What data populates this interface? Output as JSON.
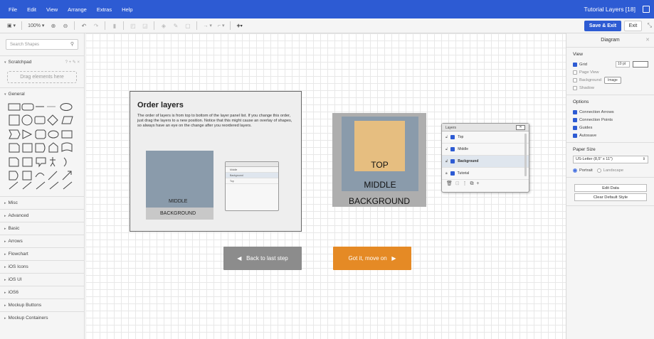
{
  "menubar": {
    "items": [
      "File",
      "Edit",
      "View",
      "Arrange",
      "Extras",
      "Help"
    ],
    "title": "Tutorial Layers [18]"
  },
  "toolbar": {
    "zoom": "100%",
    "save_exit": "Save & Exit",
    "exit": "Exit"
  },
  "sidebar": {
    "search_placeholder": "Search Shapes",
    "scratchpad": "Scratchpad",
    "scratchpad_actions": "? + ✎ ×",
    "drag_here": "Drag elements here",
    "general": "General",
    "sections": [
      "Misc",
      "Advanced",
      "Basic",
      "Arrows",
      "Flowchart",
      "iOS Icons",
      "iOS UI",
      "iOS6",
      "Mockup Buttons",
      "Mockup Containers"
    ]
  },
  "canvas": {
    "tutorial": {
      "title": "Order layers",
      "text": "The order of layers is from top to bottom of the layer panel list. If you change this order, just drag the layers to a new position. Notice that this might cause an overlay of shapes, so always have an eye on the change after you reordered layers.",
      "mini_middle": "MIDDLE",
      "mini_background": "BACKGROUND",
      "mini_rows": [
        "Middle",
        "Background",
        "Top"
      ]
    },
    "stack": {
      "top": "TOP",
      "middle": "MIDDLE",
      "background": "BACKGROUND"
    },
    "layers_panel": {
      "title": "Layers",
      "rows": [
        "Top",
        "Middle",
        "Background",
        "Tutorial"
      ]
    },
    "back_button": "Back to last step",
    "next_button": "Got it, move on"
  },
  "rpanel": {
    "title": "Diagram",
    "view_title": "View",
    "grid": "Grid",
    "grid_size": "10 pt",
    "page_view": "Page View",
    "background": "Background",
    "image_btn": "Image",
    "shadow": "Shadow",
    "options_title": "Options",
    "connection_arrows": "Connection Arrows",
    "connection_points": "Connection Points",
    "guides": "Guides",
    "autosave": "Autosave",
    "paper_title": "Paper Size",
    "paper_value": "US-Letter (8,5\" x 11\")",
    "portrait": "Portrait",
    "landscape": "Landscape",
    "edit_data": "Edit Data",
    "clear_style": "Clear Default Style"
  },
  "colors": {
    "brand": "#2d5bd3",
    "next_button": "#e58a25",
    "back_button": "#8c8c8c"
  }
}
